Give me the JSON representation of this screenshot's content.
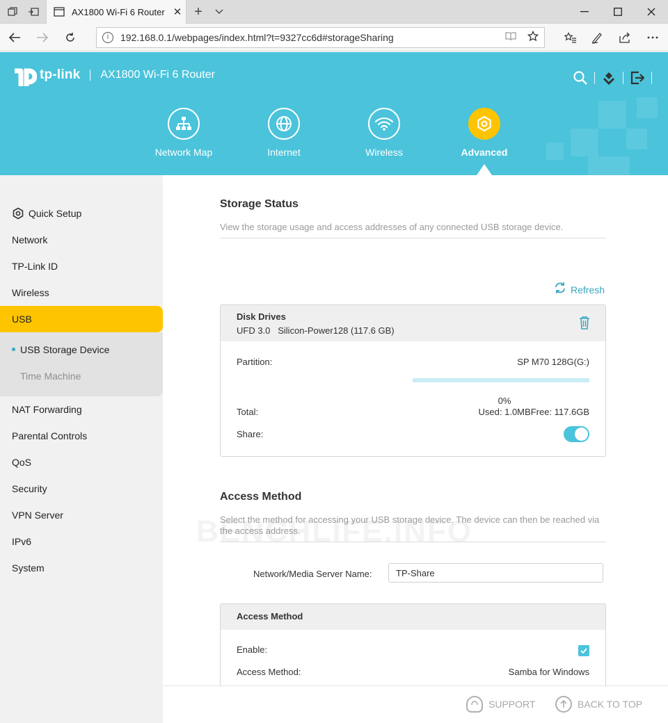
{
  "browser": {
    "tab_title": "AX1800 Wi-Fi 6 Router",
    "url": "192.168.0.1/webpages/index.html?t=9327cc6d#storageSharing"
  },
  "header": {
    "brand": "tp-link",
    "model": "AX1800 Wi-Fi 6 Router",
    "tabs": [
      {
        "label": "Network Map",
        "icon": "network-map-icon"
      },
      {
        "label": "Internet",
        "icon": "globe-icon"
      },
      {
        "label": "Wireless",
        "icon": "wifi-icon"
      },
      {
        "label": "Advanced",
        "icon": "gear-icon",
        "active": true
      }
    ]
  },
  "sidebar": {
    "items": [
      {
        "label": "Quick Setup"
      },
      {
        "label": "Network"
      },
      {
        "label": "TP-Link ID"
      },
      {
        "label": "Wireless"
      },
      {
        "label": "USB",
        "active": true
      },
      {
        "label": "NAT Forwarding"
      },
      {
        "label": "Parental Controls"
      },
      {
        "label": "QoS"
      },
      {
        "label": "Security"
      },
      {
        "label": "VPN Server"
      },
      {
        "label": "IPv6"
      },
      {
        "label": "System"
      }
    ],
    "sub_items": [
      {
        "label": "USB Storage Device",
        "current": true
      },
      {
        "label": "Time Machine"
      }
    ]
  },
  "storage_status": {
    "title": "Storage Status",
    "description": "View the storage usage and access addresses of any connected USB storage device.",
    "refresh_label": "Refresh",
    "disk": {
      "title": "Disk Drives",
      "subtitle": "UFD 3.0   Silicon-Power128 (117.6 GB)",
      "partition_label": "Partition:",
      "partition_value": "SP M70 128G(G:)",
      "usage_percent_text": "0%",
      "usage_fraction": 0,
      "total_label": "Total:",
      "used_text": "Used: 1.0MB",
      "free_text": "Free: 117.6GB",
      "share_label": "Share:",
      "share_enabled": true
    }
  },
  "access_method": {
    "title": "Access Method",
    "description": "Select the method for accessing your USB storage device. The device can then be reached via the access address.",
    "server_name_label": "Network/Media Server Name:",
    "server_name_value": "TP-Share",
    "card": {
      "title": "Access Method",
      "enable_label": "Enable:",
      "enable_checked": true,
      "method_label": "Access Method:",
      "method_value": "Samba for Windows"
    }
  },
  "watermark": "BENCHLIFE.INFO",
  "footer": {
    "support_label": "SUPPORT",
    "back_to_top_label": "BACK TO TOP"
  },
  "colors": {
    "header_teal": "#4ac3db",
    "accent_yellow": "#ffc400",
    "link_teal": "#3aa6bd"
  }
}
